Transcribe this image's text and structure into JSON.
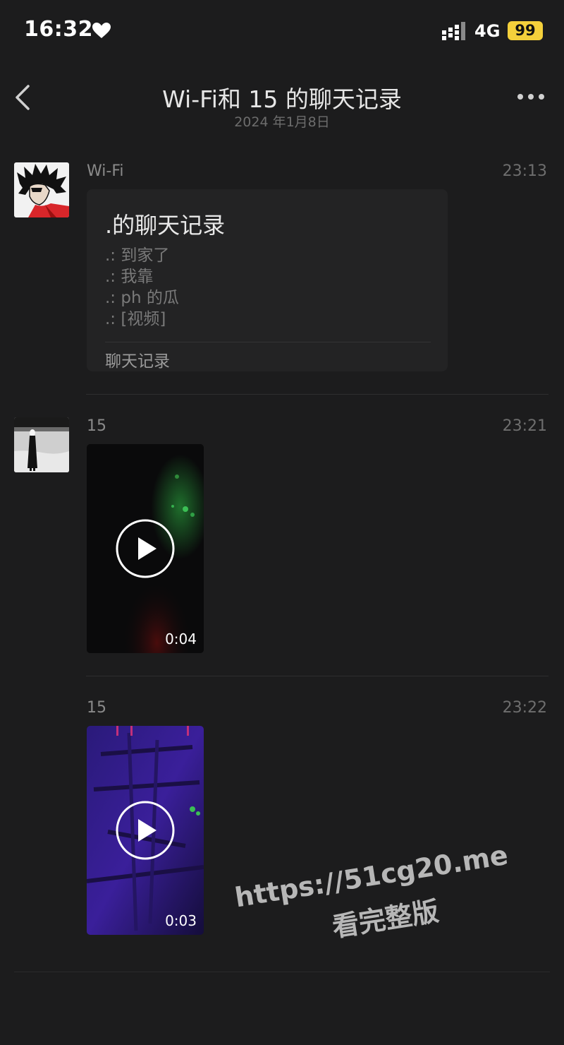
{
  "status_bar": {
    "time": "16:32",
    "network": "4G",
    "battery": "99",
    "icons": [
      "heart-icon",
      "signal-icon"
    ]
  },
  "nav": {
    "title": "Wi-Fi和 15 的聊天记录",
    "subtitle": "2024 年1月8日",
    "icons": [
      "back-icon",
      "more-icon"
    ]
  },
  "messages": [
    {
      "sender": "Wi-Fi",
      "time": "23:13",
      "card": {
        "title": ".的聊天记录",
        "lines": [
          ".: 到家了",
          ".: 我靠",
          ".: ph 的瓜",
          ".: [视频]"
        ],
        "footer": "聊天记录"
      }
    },
    {
      "sender": "15",
      "time": "23:21",
      "video": {
        "duration": "0:04"
      }
    },
    {
      "sender": "15",
      "time": "23:22",
      "video": {
        "duration": "0:03"
      }
    }
  ],
  "watermark": {
    "url": "https://51cg20.me",
    "text": "看完整版"
  },
  "colors": {
    "background": "#1c1c1d",
    "card": "#232324",
    "battery": "#f4d03b"
  }
}
